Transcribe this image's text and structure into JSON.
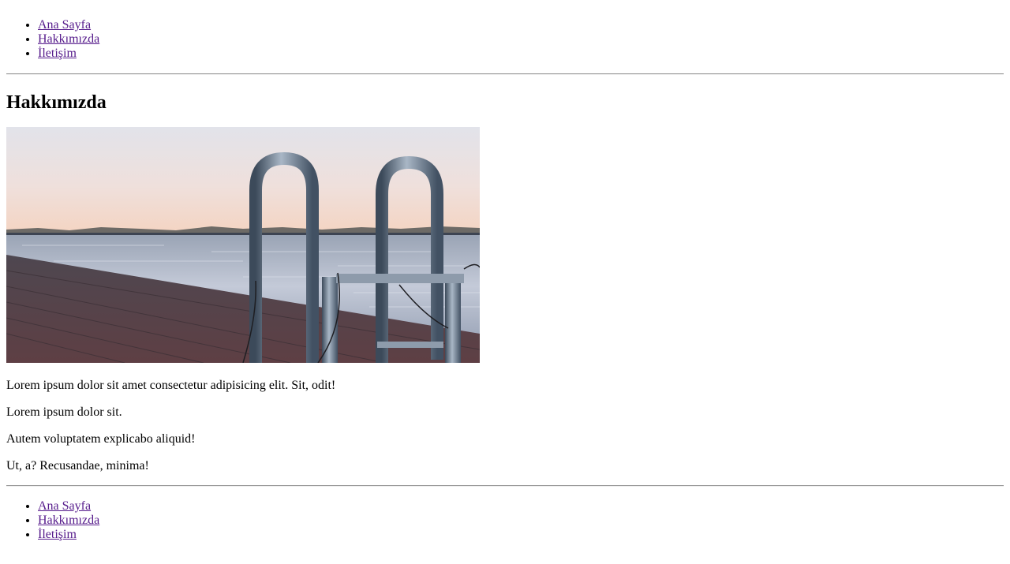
{
  "nav_top": {
    "items": [
      "Ana Sayfa",
      "Hakkımızda",
      "İletişim"
    ]
  },
  "page": {
    "title": "Hakkımızda",
    "image": "pier-ladder-photo",
    "paragraphs": [
      "Lorem ipsum dolor sit amet consectetur adipisicing elit. Sit, odit!",
      "Lorem ipsum dolor sit.",
      "Autem voluptatem explicabo aliquid!",
      "Ut, a? Recusandae, minima!"
    ]
  },
  "nav_bottom": {
    "items": [
      "Ana Sayfa",
      "Hakkımızda",
      "İletişim"
    ]
  },
  "colors": {
    "link_visited": "#551a8b",
    "text": "#000000",
    "rule": "#9a9a9a"
  }
}
